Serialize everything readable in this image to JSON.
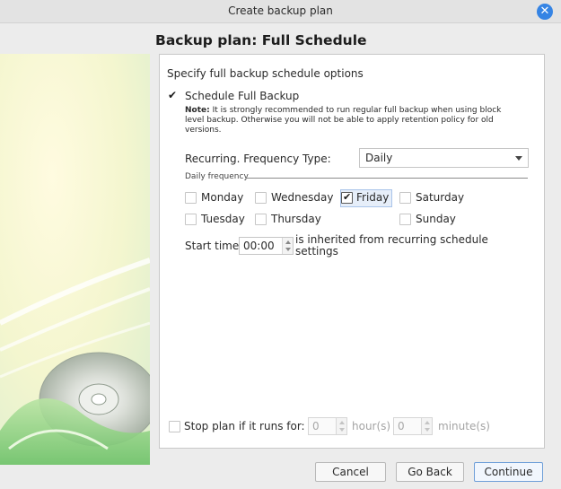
{
  "window": {
    "title": "Create backup plan",
    "close_glyph": "✕"
  },
  "header": {
    "title": "Backup plan: Full Schedule"
  },
  "panel": {
    "heading": "Specify full backup schedule options",
    "schedule_full_backup": {
      "label": "Schedule Full Backup",
      "checked": true
    },
    "note": {
      "bold": "Note:",
      "line1": "It is strongly recommended to run regular full backup when using block",
      "line2": "level backup. Otherwise you will not be able to apply retention policy for old",
      "line3": "versions."
    },
    "frequency_type": {
      "label": "Recurring. Frequency Type:",
      "value": "Daily"
    },
    "daily_frequency": {
      "label": "Daily frequency",
      "days": [
        {
          "label": "Monday",
          "checked": false
        },
        {
          "label": "Wednesday",
          "checked": false
        },
        {
          "label": "Friday",
          "checked": true
        },
        {
          "label": "Saturday",
          "checked": false
        },
        {
          "label": "Tuesday",
          "checked": false
        },
        {
          "label": "Thursday",
          "checked": false
        },
        {
          "label": "Sunday",
          "checked": false
        }
      ]
    },
    "start_time": {
      "label": "Start time",
      "value": "00:00",
      "note_line1": "is inherited from recurring schedule",
      "note_line2": "settings"
    },
    "stop_plan": {
      "label": "Stop plan if it runs for:",
      "checked": false,
      "hours_value": "0",
      "hours_unit": "hour(s)",
      "minutes_value": "0",
      "minutes_unit": "minute(s)"
    }
  },
  "footer": {
    "cancel": "Cancel",
    "back": "Go Back",
    "continue": "Continue"
  },
  "colors": {
    "accent": "#3584e4",
    "selected_bg": "#e6eef9",
    "panel_bg": "#ffffff",
    "window_bg": "#ececec"
  }
}
